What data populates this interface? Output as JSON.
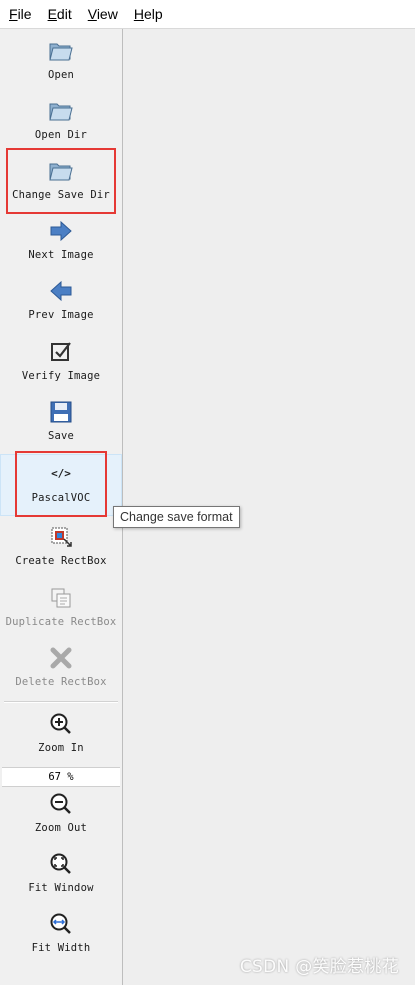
{
  "menubar": {
    "file": {
      "accel": "F",
      "rest": "ile"
    },
    "edit": {
      "accel": "E",
      "rest": "dit"
    },
    "view": {
      "accel": "V",
      "rest": "iew"
    },
    "help": {
      "accel": "H",
      "rest": "elp"
    }
  },
  "toolbar": {
    "open": "Open",
    "open_dir": "Open Dir",
    "change_save_dir": "Change Save Dir",
    "next_image": "Next Image",
    "prev_image": "Prev Image",
    "verify_image": "Verify Image",
    "save": "Save",
    "save_format": "PascalVOC",
    "save_format_icon_text": "</>",
    "create_rectbox": "Create RectBox",
    "duplicate_rectbox": "Duplicate RectBox",
    "delete_rectbox": "Delete RectBox",
    "zoom_in": "Zoom In",
    "zoom_value": "67 %",
    "zoom_out": "Zoom Out",
    "fit_window": "Fit Window",
    "fit_width": "Fit Width"
  },
  "tooltip": "Change save format",
  "watermark": "CSDN @笑脸惹桃花",
  "colors": {
    "highlight_red": "#e53935",
    "selected_bg": "#e5f1fb",
    "icon_blue": "#3a6fb7"
  },
  "icons": {
    "open": "folder-icon",
    "open_dir": "folder-icon",
    "change_save_dir": "folder-icon",
    "next_image": "arrow-right-icon",
    "prev_image": "arrow-left-icon",
    "verify_image": "checkbox-icon",
    "save": "floppy-disk-icon",
    "create_rectbox": "rectbox-icon",
    "duplicate_rectbox": "duplicate-icon",
    "delete_rectbox": "x-icon",
    "zoom_in": "zoom-in-icon",
    "zoom_out": "zoom-out-icon",
    "fit_window": "fit-window-icon",
    "fit_width": "fit-width-icon"
  }
}
